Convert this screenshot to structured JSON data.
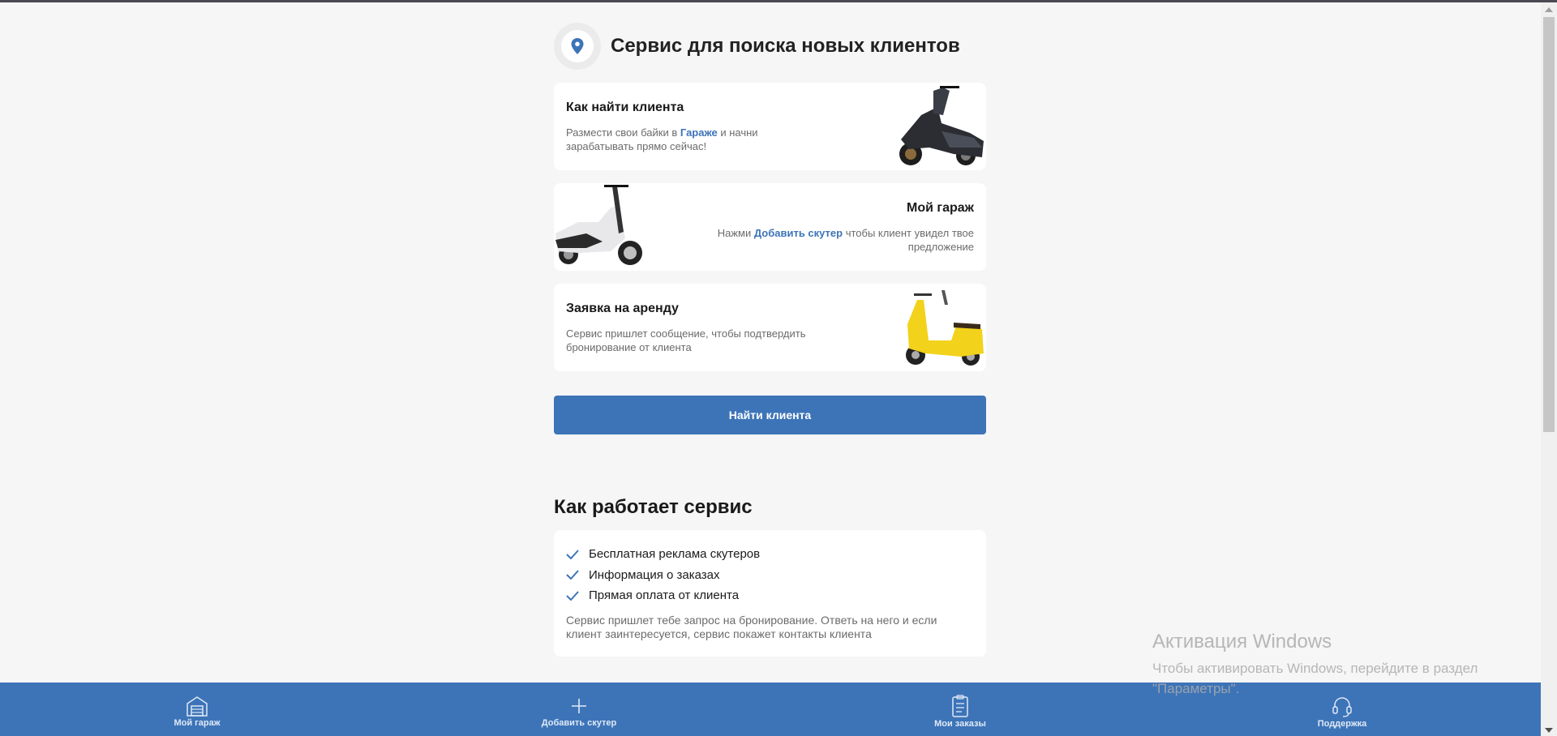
{
  "header": {
    "title": "Сервис для поиска новых клиентов"
  },
  "cards": [
    {
      "title": "Как найти клиента",
      "desc_before": "Размести свои байки в ",
      "link": "Гараже",
      "desc_after": " и начни зарабатывать прямо сейчас!"
    },
    {
      "title": "Мой гараж",
      "desc_before": "Нажми ",
      "link": "Добавить скутер",
      "desc_after": " чтобы клиент увидел твое предложение"
    },
    {
      "title": "Заявка на аренду",
      "desc_before": "Сервис пришлет сообщение, чтобы подтвердить бронирование от клиента",
      "link": "",
      "desc_after": ""
    }
  ],
  "find_button": "Найти клиента",
  "how": {
    "title": "Как работает сервис",
    "items": [
      "Бесплатная реклама скутеров",
      "Информация о заказах",
      "Прямая оплата от клиента"
    ],
    "note": "Сервис пришлет тебе запрос на бронирование. Ответь на него и если клиент заинтересуется, сервис покажет контакты клиента"
  },
  "nav": {
    "garage": {
      "label": "Мой гараж",
      "icon": "garage-icon"
    },
    "add": {
      "label": "Добавить скутер",
      "icon": "plus-icon"
    },
    "orders": {
      "label": "Мои заказы",
      "icon": "clipboard-icon"
    },
    "support": {
      "label": "Поддержка",
      "icon": "headset-icon"
    }
  },
  "watermark": {
    "title": "Активация Windows",
    "text": "Чтобы активировать Windows, перейдите в раздел \"Параметры\"."
  },
  "colors": {
    "accent": "#3d74b8",
    "background": "#f6f6f6",
    "card": "#ffffff"
  }
}
